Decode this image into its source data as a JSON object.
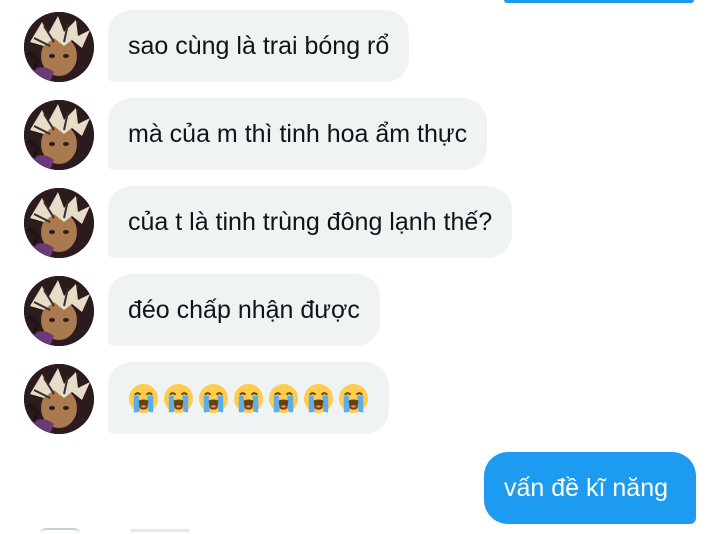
{
  "conversation": {
    "incoming": [
      {
        "text": "sao cùng là trai bóng rổ"
      },
      {
        "text": "mà của m thì tinh hoa ẩm thực"
      },
      {
        "text": "của t là tinh trùng đông lạnh thế?"
      },
      {
        "text": "đéo chấp nhận được"
      },
      {
        "emoji": "loudly-crying-face",
        "emoji_count": 7
      }
    ],
    "outgoing": [
      {
        "text": "vấn đề kĩ năng"
      }
    ]
  },
  "colors": {
    "incoming_bubble": "#eff3f4",
    "outgoing_bubble": "#1d9bf0",
    "text": "#0f1419"
  },
  "icons": {
    "avatar": "anime-character-avatar",
    "emoji": "loudly-crying-face-emoji"
  }
}
